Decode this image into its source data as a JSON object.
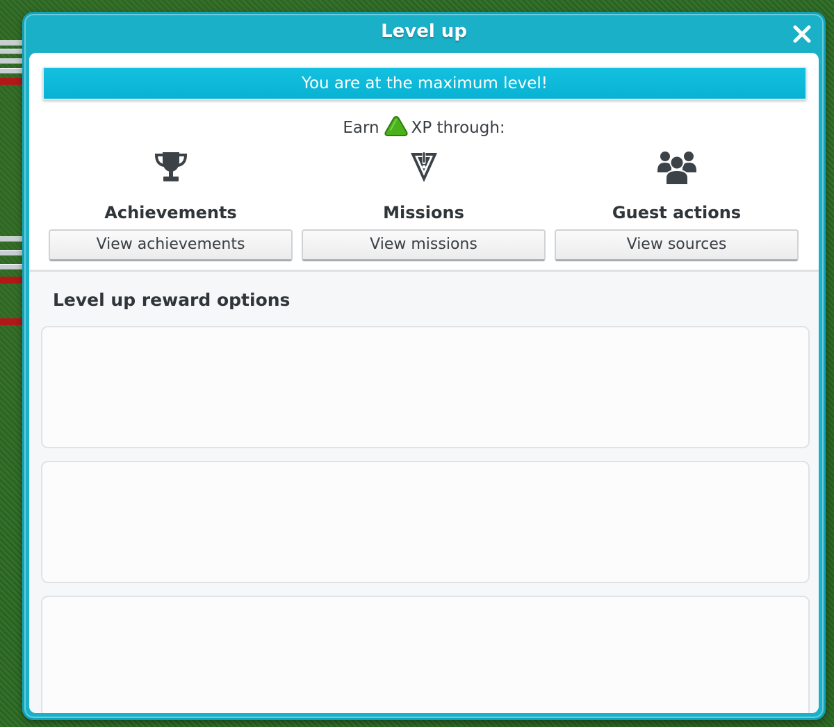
{
  "window": {
    "title": "Level up",
    "close_icon": "close-icon"
  },
  "banner": {
    "text": "You are at the maximum level!"
  },
  "earn": {
    "prefix": "Earn",
    "icon": "xp-triangle-icon",
    "suffix": "XP through:"
  },
  "sources": [
    {
      "icon": "trophy-icon",
      "title": "Achievements",
      "button_label": "View achievements"
    },
    {
      "icon": "mission-icon",
      "title": "Missions",
      "button_label": "View missions"
    },
    {
      "icon": "guests-icon",
      "title": "Guest actions",
      "button_label": "View sources"
    }
  ],
  "rewards": {
    "title": "Level up reward options",
    "cards": [
      "",
      "",
      ""
    ]
  },
  "colors": {
    "window_frame": "#1ab0c8",
    "banner": "#08b2d3",
    "xp_green": "#4caf1c",
    "icon_dark": "#3b4248"
  }
}
